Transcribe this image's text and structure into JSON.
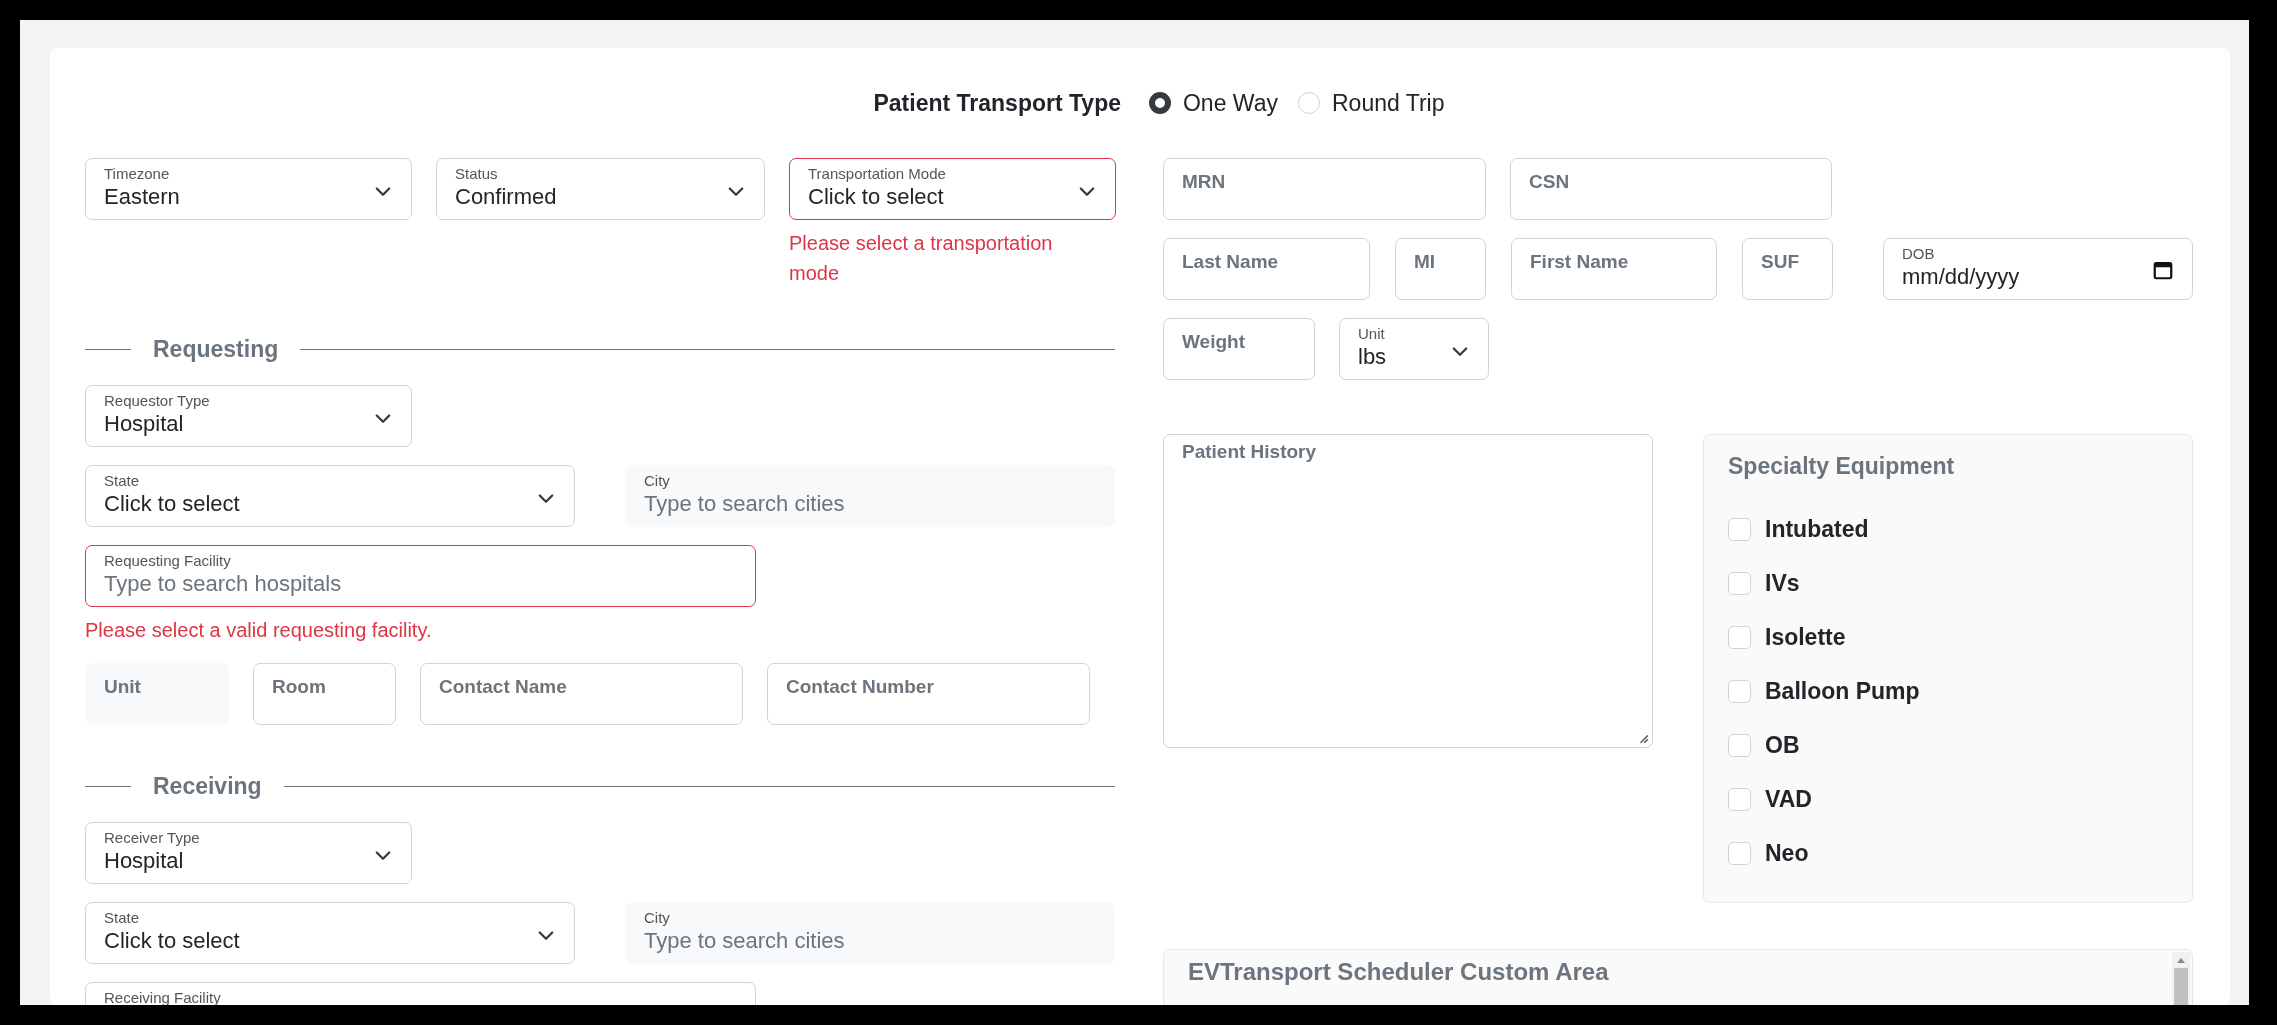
{
  "transport_type": {
    "label": "Patient Transport Type",
    "options": [
      {
        "label": "One Way",
        "selected": true
      },
      {
        "label": "Round Trip",
        "selected": false
      }
    ]
  },
  "general": [
    {
      "kind": "select",
      "label": "Timezone",
      "value": "Eastern",
      "invalid": false,
      "disabled": false
    },
    {
      "kind": "select",
      "label": "Status",
      "value": "Confirmed",
      "invalid": false,
      "disabled": false
    },
    {
      "kind": "select",
      "label": "Transportation Mode",
      "value": "Click to select",
      "invalid": true,
      "disabled": false,
      "error": "Please select a transportation mode"
    }
  ],
  "requesting": {
    "title": "Requesting",
    "type_field": [
      {
        "kind": "select",
        "label": "Requestor Type",
        "value": "Hospital",
        "invalid": false,
        "disabled": false
      }
    ],
    "location": [
      {
        "kind": "select",
        "label": "State",
        "value": "Click to select",
        "invalid": false,
        "disabled": false
      },
      {
        "kind": "search",
        "label": "City",
        "placeholder": "Type to search cities",
        "invalid": false,
        "disabled": true
      }
    ],
    "facility": [
      {
        "kind": "search",
        "label": "Requesting Facility",
        "placeholder": "Type to search hospitals",
        "invalid": true,
        "disabled": false,
        "error": "Please select a valid requesting facility."
      }
    ],
    "details": [
      {
        "kind": "text",
        "label": "Unit",
        "invalid": false,
        "disabled": true
      },
      {
        "kind": "text",
        "label": "Room",
        "invalid": false,
        "disabled": false
      },
      {
        "kind": "text",
        "label": "Contact Name",
        "invalid": false,
        "disabled": false
      },
      {
        "kind": "text",
        "label": "Contact Number",
        "invalid": false,
        "disabled": false
      }
    ]
  },
  "receiving": {
    "title": "Receiving",
    "type_field": [
      {
        "kind": "select",
        "label": "Receiver Type",
        "value": "Hospital",
        "invalid": false,
        "disabled": false
      }
    ],
    "location": [
      {
        "kind": "select",
        "label": "State",
        "value": "Click to select",
        "invalid": false,
        "disabled": false
      },
      {
        "kind": "search",
        "label": "City",
        "placeholder": "Type to search cities",
        "invalid": false,
        "disabled": true
      }
    ],
    "facility": [
      {
        "kind": "search",
        "label": "Receiving Facility",
        "invalid": false,
        "disabled": false
      }
    ]
  },
  "patient": {
    "ids": [
      {
        "kind": "text",
        "label": "MRN",
        "invalid": false,
        "disabled": false
      },
      {
        "kind": "text",
        "label": "CSN",
        "invalid": false,
        "disabled": false
      }
    ],
    "names": [
      {
        "kind": "text",
        "label": "Last Name",
        "invalid": false,
        "disabled": false
      },
      {
        "kind": "text",
        "label": "MI",
        "invalid": false,
        "disabled": false
      },
      {
        "kind": "text",
        "label": "First Name",
        "invalid": false,
        "disabled": false
      },
      {
        "kind": "text",
        "label": "SUF",
        "invalid": false,
        "disabled": false
      },
      {
        "kind": "date",
        "label": "DOB",
        "placeholder": "mm/dd/yyyy",
        "invalid": false,
        "disabled": false
      }
    ],
    "weight": [
      {
        "kind": "text",
        "label": "Weight",
        "invalid": false,
        "disabled": false
      },
      {
        "kind": "select",
        "label": "Unit",
        "value": "lbs",
        "invalid": false,
        "disabled": false
      }
    ]
  },
  "history": {
    "label": "Patient History"
  },
  "equipment": {
    "title": "Specialty Equipment",
    "items": [
      {
        "label": "Intubated",
        "checked": false
      },
      {
        "label": "IVs",
        "checked": false
      },
      {
        "label": "Isolette",
        "checked": false
      },
      {
        "label": "Balloon Pump",
        "checked": false
      },
      {
        "label": "OB",
        "checked": false
      },
      {
        "label": "VAD",
        "checked": false
      },
      {
        "label": "Neo",
        "checked": false
      }
    ]
  },
  "custom_area": {
    "title": "EVTransport Scheduler Custom Area"
  }
}
